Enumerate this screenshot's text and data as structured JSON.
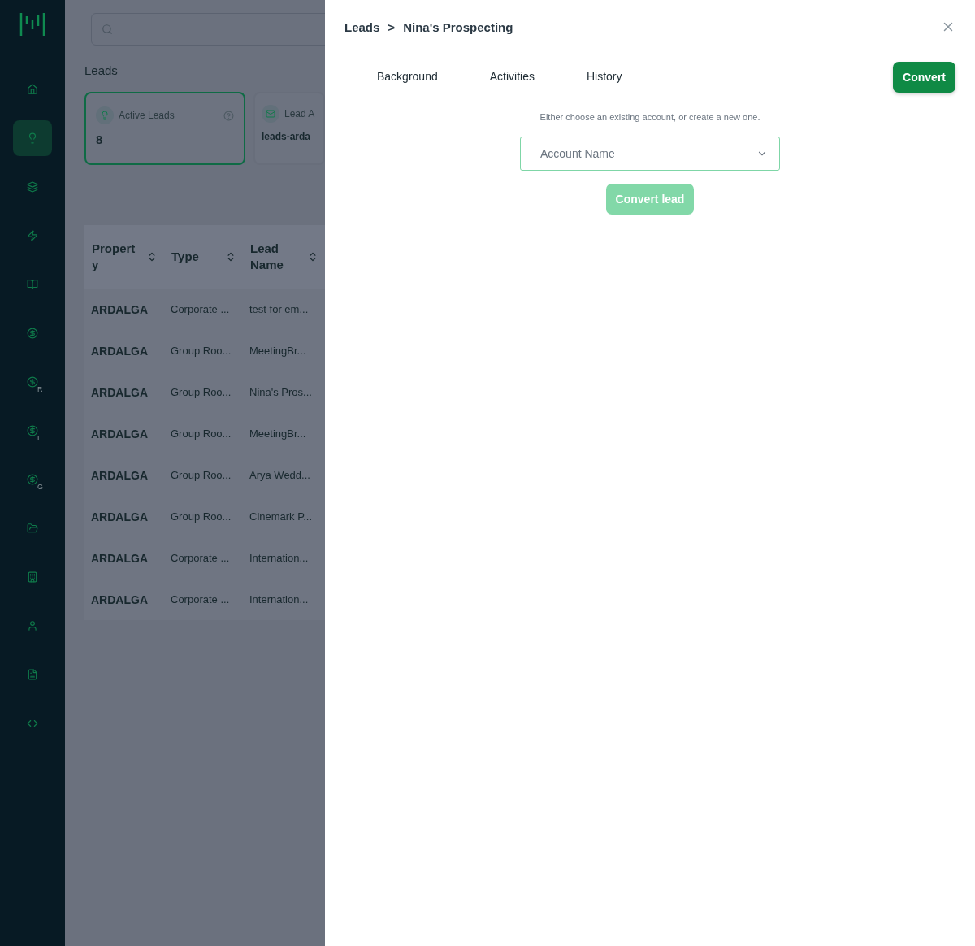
{
  "sidebar": {
    "items": [
      {
        "selected": false
      },
      {
        "selected": true
      },
      {
        "selected": false
      },
      {
        "selected": false
      },
      {
        "selected": false
      },
      {
        "selected": false
      },
      {
        "sub": "R",
        "selected": false
      },
      {
        "sub": "L",
        "selected": false
      },
      {
        "sub": "G",
        "selected": false
      },
      {
        "selected": false
      },
      {
        "selected": false
      },
      {
        "selected": false
      },
      {
        "selected": false
      },
      {
        "selected": false
      }
    ]
  },
  "page": {
    "title": "Leads",
    "cards": [
      {
        "label": "Active Leads",
        "value": "8",
        "selected": true
      },
      {
        "label": "Lead A",
        "value": "leads-arda",
        "selected": false
      }
    ],
    "table": {
      "columns": [
        "Property",
        "Type",
        "Lead Name"
      ],
      "rows": [
        [
          "ARDALGA",
          "Corporate ...",
          "test for em..."
        ],
        [
          "ARDALGA",
          "Group Roo...",
          "MeetingBr..."
        ],
        [
          "ARDALGA",
          "Group Roo...",
          "Nina's Pros..."
        ],
        [
          "ARDALGA",
          "Group Roo...",
          "MeetingBr..."
        ],
        [
          "ARDALGA",
          "Group Roo...",
          "Arya Wedd..."
        ],
        [
          "ARDALGA",
          "Group Roo...",
          "Cinemark P..."
        ],
        [
          "ARDALGA",
          "Corporate ...",
          "Internation..."
        ],
        [
          "ARDALGA",
          "Corporate ...",
          "Internation..."
        ]
      ]
    }
  },
  "drawer": {
    "breadcrumb": [
      "Leads",
      "Nina's Prospecting"
    ],
    "separator": ">",
    "tabs": [
      {
        "label": "Background",
        "selected": false
      },
      {
        "label": "Activities",
        "selected": false
      },
      {
        "label": "History",
        "selected": false
      }
    ],
    "convert_button": "Convert",
    "hint": "Either choose an existing account, or create a new one.",
    "account_select": {
      "placeholder": "Account Name"
    },
    "convert_lead_button": {
      "label": "Convert lead",
      "disabled": true
    }
  }
}
